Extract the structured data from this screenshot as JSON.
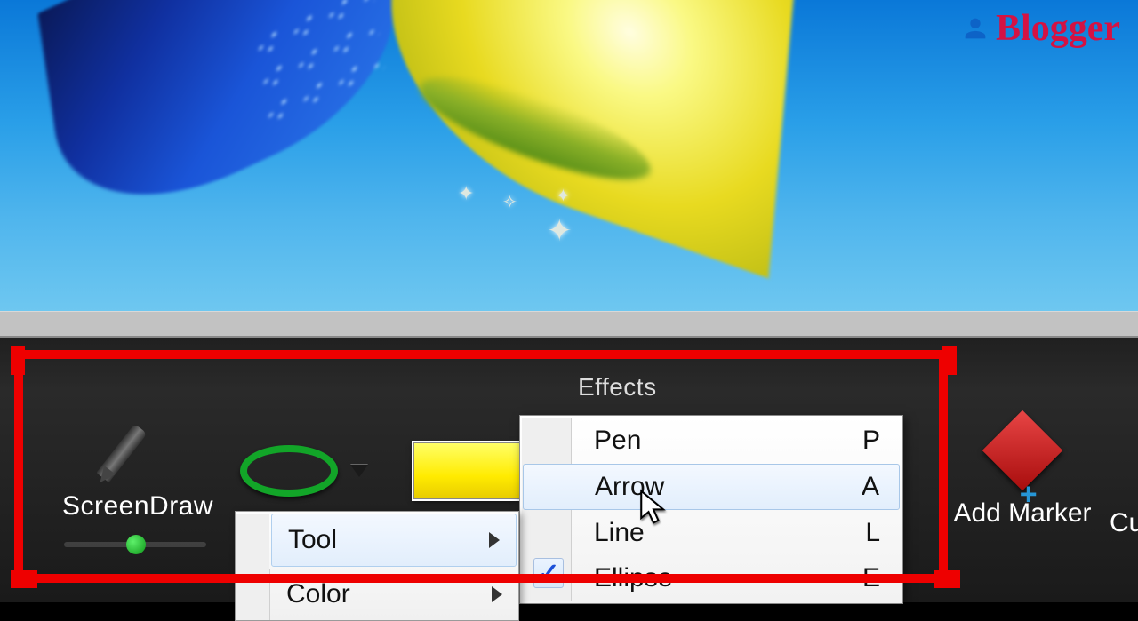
{
  "brand": {
    "name": "Blogger"
  },
  "toolbar": {
    "section_title": "Effects",
    "screendraw_label": "ScreenDraw",
    "add_marker_label": "Add Marker",
    "truncated_label": "Cu"
  },
  "context_menu": {
    "items": [
      {
        "label": "Tool",
        "highlighted": true
      },
      {
        "label": "Color",
        "highlighted": false
      }
    ]
  },
  "tool_submenu": {
    "items": [
      {
        "label": "Pen",
        "shortcut": "P",
        "checked": false,
        "highlighted": false
      },
      {
        "label": "Arrow",
        "shortcut": "A",
        "checked": false,
        "highlighted": true
      },
      {
        "label": "Line",
        "shortcut": "L",
        "checked": false,
        "highlighted": false
      },
      {
        "label": "Ellipse",
        "shortcut": "E",
        "checked": true,
        "highlighted": false
      }
    ]
  },
  "colors": {
    "highlight_border": "#ee0000",
    "swatch": "#ffeb00",
    "ellipse_ring": "#12a528"
  }
}
